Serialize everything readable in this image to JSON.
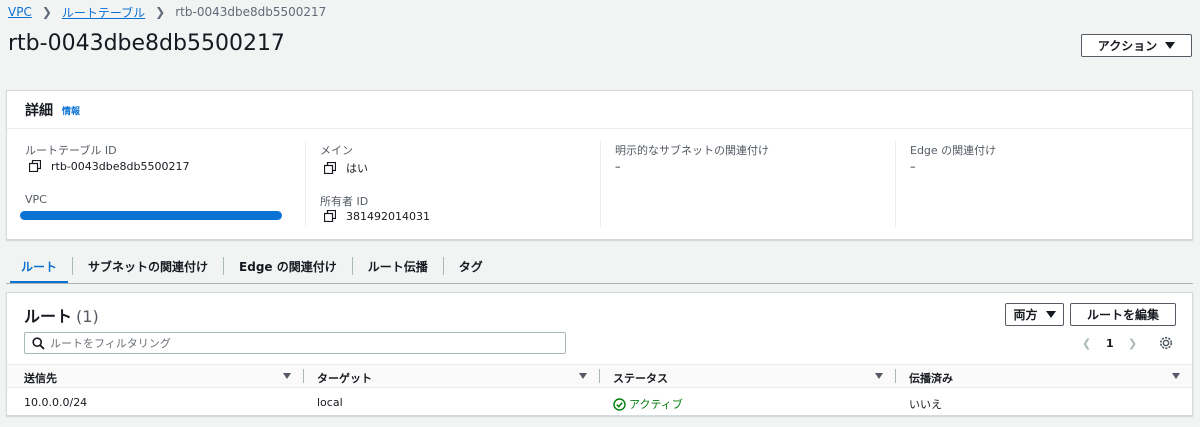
{
  "breadcrumb": {
    "items": [
      "VPC",
      "ルートテーブル"
    ],
    "current": "rtb-0043dbe8db5500217"
  },
  "page": {
    "title": "rtb-0043dbe8db5500217",
    "actions_label": "アクション"
  },
  "details": {
    "title": "詳細",
    "info_label": "情報",
    "fields": {
      "route_table_id": {
        "label": "ルートテーブル ID",
        "value": "rtb-0043dbe8db5500217"
      },
      "vpc": {
        "label": "VPC"
      },
      "main": {
        "label": "メイン",
        "value": "はい"
      },
      "owner_id": {
        "label": "所有者 ID",
        "value": "381492014031"
      },
      "explicit_subnet": {
        "label": "明示的なサブネットの関連付け",
        "value": "–"
      },
      "edge": {
        "label": "Edge の関連付け",
        "value": "–"
      }
    }
  },
  "tabs": [
    {
      "label": "ルート",
      "active": true
    },
    {
      "label": "サブネットの関連付け",
      "active": false
    },
    {
      "label": "Edge の関連付け",
      "active": false
    },
    {
      "label": "ルート伝播",
      "active": false
    },
    {
      "label": "タグ",
      "active": false
    }
  ],
  "routes": {
    "title": "ルート",
    "count": "(1)",
    "filter_label": "両方",
    "edit_label": "ルートを編集",
    "search_placeholder": "ルートをフィルタリング",
    "page_number": "1",
    "columns": [
      "送信先",
      "ターゲット",
      "ステータス",
      "伝播済み"
    ],
    "rows": [
      {
        "destination": "10.0.0.0/24",
        "target": "local",
        "status": "アクティブ",
        "propagated": "いいえ"
      }
    ]
  },
  "colors": {
    "link": "#0972d3",
    "status_active": "#037f0c",
    "vpc_redaction": "#0a73d4"
  }
}
